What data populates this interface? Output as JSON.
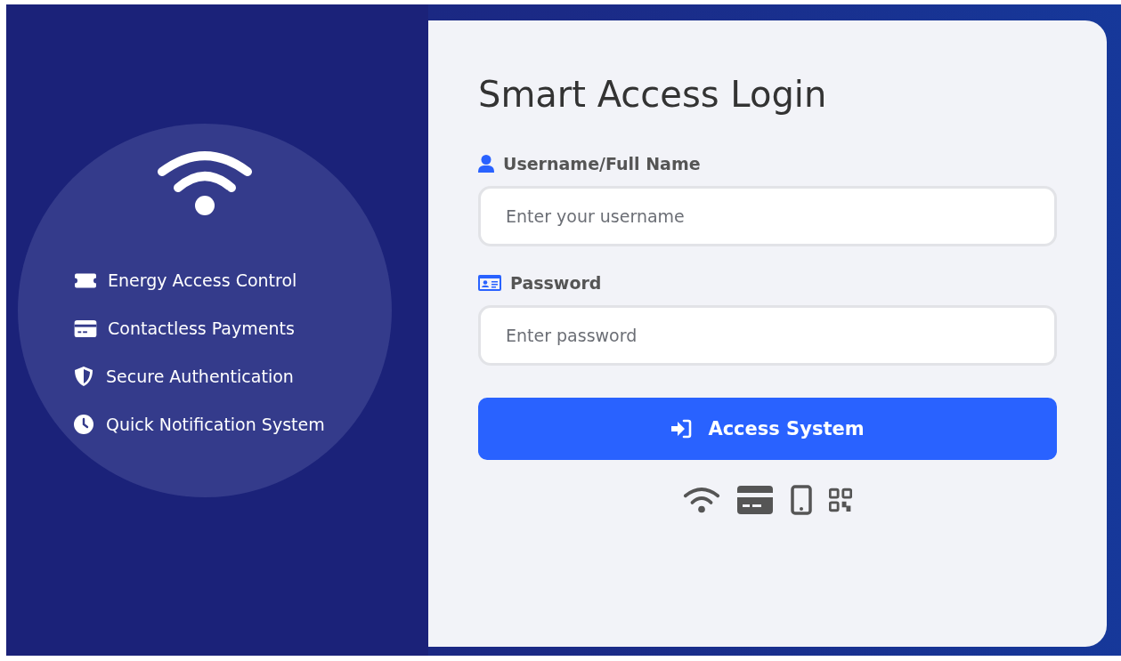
{
  "features": [
    {
      "label": "Energy Access Control"
    },
    {
      "label": "Contactless Payments"
    },
    {
      "label": "Secure Authentication"
    },
    {
      "label": "Quick Notification System"
    }
  ],
  "form": {
    "title": "Smart Access Login",
    "fields": [
      {
        "label": "Username/Full Name",
        "placeholder": "Enter your username"
      },
      {
        "label": "Password",
        "placeholder": "Enter password"
      }
    ],
    "submit": {
      "label": "Access System"
    }
  }
}
